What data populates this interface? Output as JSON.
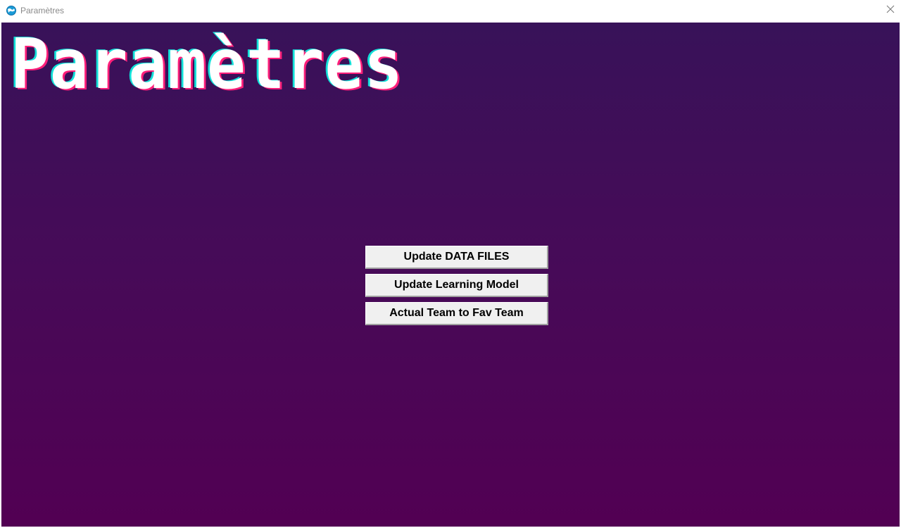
{
  "window": {
    "title": "Paramètres",
    "icon": "globe-app-icon",
    "close_icon": "close-icon"
  },
  "page": {
    "heading": "Paramètres"
  },
  "buttons": [
    {
      "label": "Update DATA FILES"
    },
    {
      "label": "Update Learning Model"
    },
    {
      "label": "Actual Team to Fav Team"
    }
  ],
  "colors": {
    "background_top": "#381259",
    "background_bottom": "#520053",
    "title_text": "#ffffff",
    "title_glitch_pink": "#ff1f7a",
    "title_glitch_cyan": "#11e0d8",
    "button_face": "#f0f0f0"
  }
}
